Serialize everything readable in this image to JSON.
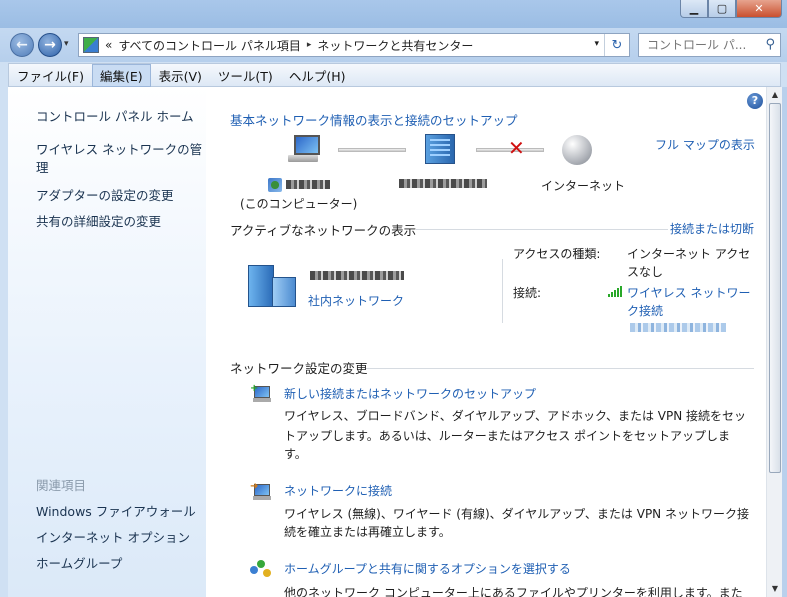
{
  "window": {
    "controls": {
      "minimize": "▁",
      "maximize": "▢",
      "close": "✕"
    }
  },
  "nav": {
    "back_icon": "arrow-left-icon",
    "forward_icon": "arrow-right-icon",
    "history_dropdown": "▾",
    "breadcrumb_overflow": "«",
    "breadcrumbs": [
      "すべてのコントロール パネル項目",
      "ネットワークと共有センター"
    ],
    "breadcrumb_separator": "▸",
    "address_dropdown": "▾",
    "refresh": "↻",
    "search_placeholder": "コントロール パ...",
    "search_icon": "⚲"
  },
  "menubar": {
    "items": [
      "ファイル(F)",
      "編集(E)",
      "表示(V)",
      "ツール(T)",
      "ヘルプ(H)"
    ],
    "active_index": 1
  },
  "sidebar": {
    "home": "コントロール パネル ホーム",
    "links": [
      "ワイヤレス ネットワークの管理",
      "アダプターの設定の変更",
      "共有の詳細設定の変更"
    ],
    "related_header": "関連項目",
    "related": [
      "Windows ファイアウォール",
      "インターネット オプション",
      "ホームグループ"
    ]
  },
  "main": {
    "help": "?",
    "basic_title": "基本ネットワーク情報の表示と接続のセットアップ",
    "full_map_link": "フル マップの表示",
    "map": {
      "this_computer": "(このコンピューター)",
      "internet": "インターネット",
      "broken_mark": "✕"
    },
    "active_header": "アクティブなネットワークの表示",
    "connect_disconnect_link": "接続または切断",
    "network": {
      "category_link": "社内ネットワーク",
      "access_type_label": "アクセスの種類:",
      "access_type_value_line1": "インターネット アクセ",
      "access_type_value_line2": "スなし",
      "connections_label": "接続:",
      "connection_link_line1": "ワイヤレス ネットワー",
      "connection_link_line2": "ク接続"
    },
    "change_header": "ネットワーク設定の変更",
    "tasks": [
      {
        "title": "新しい接続またはネットワークのセットアップ",
        "desc1": "ワイヤレス、ブロードバンド、ダイヤルアップ、アドホック、または VPN 接続をセッ",
        "desc2": "トアップします。あるいは、ルーターまたはアクセス ポイントをセットアップしま",
        "desc3": "す。"
      },
      {
        "title": "ネットワークに接続",
        "desc1": "ワイヤレス (無線)、ワイヤード (有線)、ダイヤルアップ、または VPN ネットワーク接",
        "desc2": "続を確立または再確立します。"
      },
      {
        "title": "ホームグループと共有に関するオプションを選択する",
        "desc1": "他のネットワーク コンピューター上にあるファイルやプリンターを利用します。また"
      }
    ]
  }
}
